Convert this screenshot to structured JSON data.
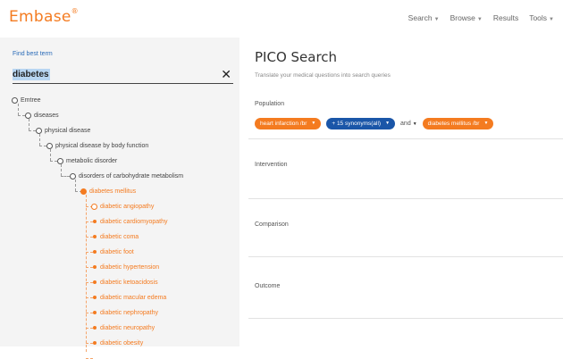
{
  "header": {
    "logo": "Embase",
    "logo_mark": "®",
    "nav": [
      "Search",
      "Browse",
      "Results",
      "Tools"
    ]
  },
  "left_panel": {
    "find_label": "Find best term",
    "search_value": "diabetes",
    "tree": [
      {
        "label": "Emtree",
        "depth": 0,
        "style": "circle"
      },
      {
        "label": "diseases",
        "depth": 1,
        "style": "circle"
      },
      {
        "label": "physical disease",
        "depth": 2,
        "style": "circle"
      },
      {
        "label": "physical disease by body function",
        "depth": 3,
        "style": "circle"
      },
      {
        "label": "metabolic disorder",
        "depth": 4,
        "style": "circle"
      },
      {
        "label": "disorders of carbohydrate metabolism",
        "depth": 5,
        "style": "circle"
      },
      {
        "label": "diabetes mellitus",
        "depth": 6,
        "style": "selected"
      },
      {
        "label": "diabetic angiopathy",
        "depth": 7,
        "style": "orange-circle"
      },
      {
        "label": "diabetic cardiomyopathy",
        "depth": 7,
        "style": "dot"
      },
      {
        "label": "diabetic coma",
        "depth": 7,
        "style": "dot"
      },
      {
        "label": "diabetic foot",
        "depth": 7,
        "style": "dot"
      },
      {
        "label": "diabetic hypertension",
        "depth": 7,
        "style": "dot"
      },
      {
        "label": "diabetic ketoacidosis",
        "depth": 7,
        "style": "dot"
      },
      {
        "label": "diabetic macular edema",
        "depth": 7,
        "style": "dot"
      },
      {
        "label": "diabetic nephropathy",
        "depth": 7,
        "style": "dot"
      },
      {
        "label": "diabetic neuropathy",
        "depth": 7,
        "style": "dot"
      },
      {
        "label": "diabetic obesity",
        "depth": 7,
        "style": "dot"
      }
    ]
  },
  "main": {
    "title": "PICO Search",
    "subtitle": "Translate your medical questions into search queries",
    "population_label": "Population",
    "population_pills": {
      "term1": "heart infarction /br",
      "synonyms": "+ 15 synonyms(all)",
      "operator": "and",
      "term2": "diabetes mellitus /br"
    },
    "intervention_label": "Intervention",
    "comparison_label": "Comparison",
    "outcome_label": "Outcome"
  },
  "colors": {
    "brand_orange": "#f47b20",
    "pill_blue": "#1a56a8",
    "link_blue": "#2a6bb8",
    "panel_gray": "#f4f4f4"
  }
}
